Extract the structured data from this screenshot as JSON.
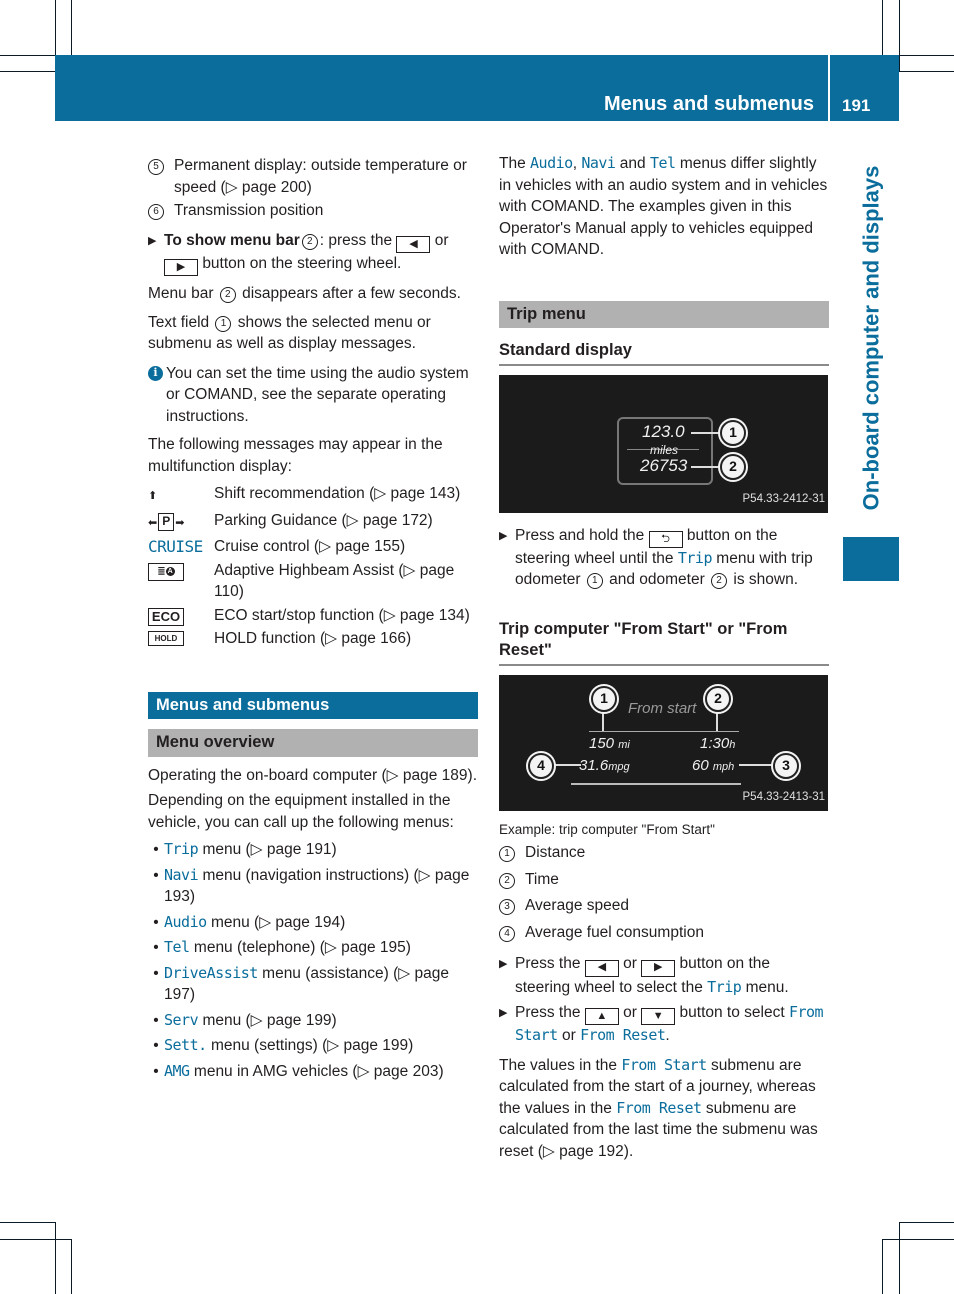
{
  "header": {
    "section_title": "Menus and submenus",
    "page_number": "191",
    "chapter_tab": "On-board computer and displays"
  },
  "colors": {
    "accent": "#0a6d9c",
    "section_grey": "#b1b1b1"
  },
  "left_column": {
    "legend_items": [
      {
        "num": "5",
        "text": "Permanent display: outside temperature or speed (▷ page 200)"
      },
      {
        "num": "6",
        "text": "Transmission position"
      }
    ],
    "step_show_menu": {
      "bold": "To show menu bar",
      "num": "2",
      "text_a": ": press the",
      "key1": "◀",
      "text_b": "or",
      "key2": "▶",
      "text_c": "button on the steering wheel."
    },
    "menu_bar_para": {
      "a": "Menu bar",
      "num": "2",
      "b": "disappears after a few seconds."
    },
    "text_field_para": {
      "a": "Text field",
      "num": "1",
      "b": "shows the selected menu or submenu as well as display messages."
    },
    "info_note": {
      "icon": "info-icon",
      "text": "You can set the time using the audio system or COMAND, see the separate operating instructions."
    },
    "messages_intro": "The following messages may appear in the multifunction display:",
    "messages": [
      {
        "icon": "shift-up-arrow-icon",
        "glyph": "⬆",
        "text": "Shift recommendation (▷ page 143)"
      },
      {
        "icon": "parking-guidance-icon",
        "glyph": "P",
        "text": "Parking Guidance (▷ page 172)"
      },
      {
        "icon": "cruise-text-icon",
        "glyph": "CRUISE",
        "text": "Cruise control (▷ page 155)"
      },
      {
        "icon": "highbeam-assist-icon",
        "glyph": "≣A",
        "text": "Adaptive Highbeam Assist (▷ page 110)"
      },
      {
        "icon": "eco-icon",
        "glyph": "ECO",
        "text": "ECO start/stop function (▷ page 134)"
      },
      {
        "icon": "hold-icon",
        "glyph": "HOLD",
        "text": "HOLD function (▷ page 166)"
      }
    ],
    "section_title": "Menus and submenus",
    "subsection_title": "Menu overview",
    "overview_para_1": "Operating the on-board computer (▷ page 189).",
    "overview_para_2": "Depending on the equipment installed in the vehicle, you can call up the following menus:",
    "menus": [
      {
        "name": "Trip",
        "text": "menu (▷ page 191)"
      },
      {
        "name": "Navi",
        "text": "menu (navigation instructions) (▷ page 193)"
      },
      {
        "name": "Audio",
        "text": "menu (▷ page 194)"
      },
      {
        "name": "Tel",
        "text": "menu (telephone) (▷ page 195)"
      },
      {
        "name": "DriveAssist",
        "text": "menu (assistance) (▷ page 197)"
      },
      {
        "name": "Serv",
        "text": "menu (▷ page 199)"
      },
      {
        "name": "Sett.",
        "text": "menu (settings) (▷ page 199)"
      },
      {
        "name": "AMG",
        "text": "menu in AMG vehicles (▷ page 203)"
      }
    ]
  },
  "right_column": {
    "intro": {
      "a": "The",
      "m1": "Audio",
      "sep": ",",
      "m2": "Navi",
      "and": "and",
      "m3": "Tel",
      "b": "menus differ slightly in vehicles with an audio system and in vehicles with COMAND. The examples given in this Operator's Manual apply to vehicles equipped with COMAND."
    },
    "section_title": "Trip menu",
    "standard_display": {
      "heading": "Standard display",
      "figure": {
        "trip_odometer": "123.0",
        "unit": "miles",
        "odometer": "26753",
        "callouts": [
          "1",
          "2"
        ],
        "code": "P54.33-2412-31"
      },
      "step": {
        "a": "Press and hold the",
        "key": "⮌",
        "b": "button on the steering wheel until the",
        "menu": "Trip",
        "c": "menu with trip odometer",
        "n1": "1",
        "d": "and odometer",
        "n2": "2",
        "e": "is shown."
      }
    },
    "trip_computer": {
      "heading": "Trip computer \"From Start\" or \"From Reset\"",
      "figure": {
        "title": "From start",
        "distance": "150",
        "distance_unit": "mi",
        "time": "1:30",
        "time_unit": "h",
        "fuel": "31.6",
        "fuel_unit": "mpg",
        "speed": "60",
        "speed_unit": "mph",
        "callouts": [
          "1",
          "2",
          "3",
          "4"
        ],
        "code": "P54.33-2413-31"
      },
      "caption": "Example: trip computer \"From Start\"",
      "legend": [
        {
          "num": "1",
          "text": "Distance"
        },
        {
          "num": "2",
          "text": "Time"
        },
        {
          "num": "3",
          "text": "Average speed"
        },
        {
          "num": "4",
          "text": "Average fuel consumption"
        }
      ],
      "step_1": {
        "a": "Press the",
        "k1": "◀",
        "or": "or",
        "k2": "▶",
        "b": "button on the steering wheel to select the",
        "menu": "Trip",
        "c": "menu."
      },
      "step_2": {
        "a": "Press the",
        "k1": "▲",
        "or": "or",
        "k2": "▼",
        "b": "button to select",
        "m1": "From Start",
        "or2": "or",
        "m2": "From Reset",
        "end": "."
      },
      "closing": {
        "a": "The values in the",
        "m1": "From Start",
        "b": "submenu are calculated from the start of a journey, whereas the values in the",
        "m2": "From Reset",
        "c": "submenu are calculated from the last time the submenu was reset (▷ page 192)."
      }
    }
  }
}
